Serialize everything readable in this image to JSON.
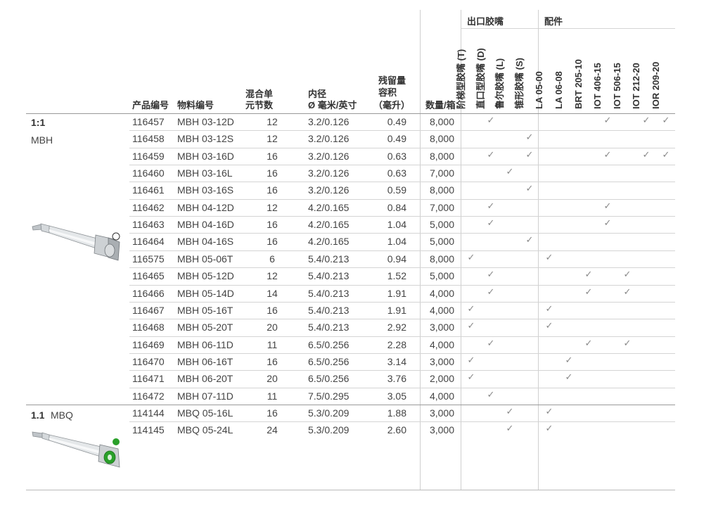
{
  "headers": {
    "product_no": "产品编号",
    "material_no": "物料编号",
    "elements_1": "混合单",
    "elements_2": "元节数",
    "bore_1": "内径",
    "bore_2": "Ø 毫米/英寸",
    "hold_1": "残留量",
    "hold_2": "容积",
    "hold_3": "（毫升）",
    "qty": "数量/箱",
    "outlet_group": "出口胶嘴",
    "accessory_group": "配件",
    "outlet_cols": [
      "阶梯型胶嘴 (T)",
      "直口型胶嘴 (D)",
      "鲁尔胶嘴 (L)",
      "锥形胶嘴 (S)"
    ],
    "accessory_cols": [
      "LA 05-00",
      "LA 06-08",
      "BRT 205-10",
      "IOT 406-15",
      "IOT 506-15",
      "IOT 212-20",
      "IOR 209-20"
    ]
  },
  "groups": [
    {
      "ratio": "1:1",
      "name": "MBH",
      "icon": "mixer-nozzle-mbh-image",
      "dot_color": "#ffffff"
    },
    {
      "ratio": "1.1",
      "name": "MBQ",
      "icon": "mixer-nozzle-mbq-image",
      "dot_color": "#2aa02a"
    }
  ],
  "check_mark": "✓",
  "rows": [
    {
      "pn": "116457",
      "mat": "MBH 03-12D",
      "el": "12",
      "bore": "3.2/0.126",
      "hold": "0.49",
      "qty": "8,000",
      "o": [
        0,
        1,
        0,
        0
      ],
      "a": [
        0,
        0,
        0,
        1,
        0,
        1,
        1
      ]
    },
    {
      "pn": "116458",
      "mat": "MBH 03-12S",
      "el": "12",
      "bore": "3.2/0.126",
      "hold": "0.49",
      "qty": "8,000",
      "o": [
        0,
        0,
        0,
        1
      ],
      "a": [
        0,
        0,
        0,
        0,
        0,
        0,
        0
      ]
    },
    {
      "pn": "116459",
      "mat": "MBH 03-16D",
      "el": "16",
      "bore": "3.2/0.126",
      "hold": "0.63",
      "qty": "8,000",
      "o": [
        0,
        1,
        0,
        1
      ],
      "a": [
        0,
        0,
        0,
        1,
        0,
        1,
        1
      ]
    },
    {
      "pn": "116460",
      "mat": "MBH 03-16L",
      "el": "16",
      "bore": "3.2/0.126",
      "hold": "0.63",
      "qty": "7,000",
      "o": [
        0,
        0,
        1,
        0
      ],
      "a": [
        0,
        0,
        0,
        0,
        0,
        0,
        0
      ]
    },
    {
      "pn": "116461",
      "mat": "MBH 03-16S",
      "el": "16",
      "bore": "3.2/0.126",
      "hold": "0.59",
      "qty": "8,000",
      "o": [
        0,
        0,
        0,
        1
      ],
      "a": [
        0,
        0,
        0,
        0,
        0,
        0,
        0
      ]
    },
    {
      "pn": "116462",
      "mat": "MBH 04-12D",
      "el": "12",
      "bore": "4.2/0.165",
      "hold": "0.84",
      "qty": "7,000",
      "o": [
        0,
        1,
        0,
        0
      ],
      "a": [
        0,
        0,
        0,
        1,
        0,
        0,
        0
      ]
    },
    {
      "pn": "116463",
      "mat": "MBH 04-16D",
      "el": "16",
      "bore": "4.2/0.165",
      "hold": "1.04",
      "qty": "5,000",
      "o": [
        0,
        1,
        0,
        0
      ],
      "a": [
        0,
        0,
        0,
        1,
        0,
        0,
        0
      ]
    },
    {
      "pn": "116464",
      "mat": "MBH 04-16S",
      "el": "16",
      "bore": "4.2/0.165",
      "hold": "1.04",
      "qty": "5,000",
      "o": [
        0,
        0,
        0,
        1
      ],
      "a": [
        0,
        0,
        0,
        0,
        0,
        0,
        0
      ]
    },
    {
      "pn": "116575",
      "mat": "MBH 05-06T",
      "el": "6",
      "bore": "5.4/0.213",
      "hold": "0.94",
      "qty": "8,000",
      "o": [
        1,
        0,
        0,
        0
      ],
      "a": [
        1,
        0,
        0,
        0,
        0,
        0,
        0
      ]
    },
    {
      "pn": "116465",
      "mat": "MBH 05-12D",
      "el": "12",
      "bore": "5.4/0.213",
      "hold": "1.52",
      "qty": "5,000",
      "o": [
        0,
        1,
        0,
        0
      ],
      "a": [
        0,
        0,
        1,
        0,
        1,
        0,
        0
      ]
    },
    {
      "pn": "116466",
      "mat": "MBH 05-14D",
      "el": "14",
      "bore": "5.4/0.213",
      "hold": "1.91",
      "qty": "4,000",
      "o": [
        0,
        1,
        0,
        0
      ],
      "a": [
        0,
        0,
        1,
        0,
        1,
        0,
        0
      ]
    },
    {
      "pn": "116467",
      "mat": "MBH 05-16T",
      "el": "16",
      "bore": "5.4/0.213",
      "hold": "1.91",
      "qty": "4,000",
      "o": [
        1,
        0,
        0,
        0
      ],
      "a": [
        1,
        0,
        0,
        0,
        0,
        0,
        0
      ]
    },
    {
      "pn": "116468",
      "mat": "MBH 05-20T",
      "el": "20",
      "bore": "5.4/0.213",
      "hold": "2.92",
      "qty": "3,000",
      "o": [
        1,
        0,
        0,
        0
      ],
      "a": [
        1,
        0,
        0,
        0,
        0,
        0,
        0
      ]
    },
    {
      "pn": "116469",
      "mat": "MBH 06-11D",
      "el": "11",
      "bore": "6.5/0.256",
      "hold": "2.28",
      "qty": "4,000",
      "o": [
        0,
        1,
        0,
        0
      ],
      "a": [
        0,
        0,
        1,
        0,
        1,
        0,
        0
      ]
    },
    {
      "pn": "116470",
      "mat": "MBH 06-16T",
      "el": "16",
      "bore": "6.5/0.256",
      "hold": "3.14",
      "qty": "3,000",
      "o": [
        1,
        0,
        0,
        0
      ],
      "a": [
        0,
        1,
        0,
        0,
        0,
        0,
        0
      ]
    },
    {
      "pn": "116471",
      "mat": "MBH 06-20T",
      "el": "20",
      "bore": "6.5/0.256",
      "hold": "3.76",
      "qty": "2,000",
      "o": [
        1,
        0,
        0,
        0
      ],
      "a": [
        0,
        1,
        0,
        0,
        0,
        0,
        0
      ]
    },
    {
      "pn": "116472",
      "mat": "MBH 07-11D",
      "el": "11",
      "bore": "7.5/0.295",
      "hold": "3.05",
      "qty": "4,000",
      "o": [
        0,
        1,
        0,
        0
      ],
      "a": [
        0,
        0,
        0,
        0,
        0,
        0,
        0
      ]
    },
    {
      "pn": "114144",
      "mat": "MBQ 05-16L",
      "el": "16",
      "bore": "5.3/0.209",
      "hold": "1.88",
      "qty": "3,000",
      "o": [
        0,
        0,
        1,
        0
      ],
      "a": [
        1,
        0,
        0,
        0,
        0,
        0,
        0
      ]
    },
    {
      "pn": "114145",
      "mat": "MBQ 05-24L",
      "el": "24",
      "bore": "5.3/0.209",
      "hold": "2.60",
      "qty": "3,000",
      "o": [
        0,
        0,
        1,
        0
      ],
      "a": [
        1,
        0,
        0,
        0,
        0,
        0,
        0
      ]
    }
  ]
}
